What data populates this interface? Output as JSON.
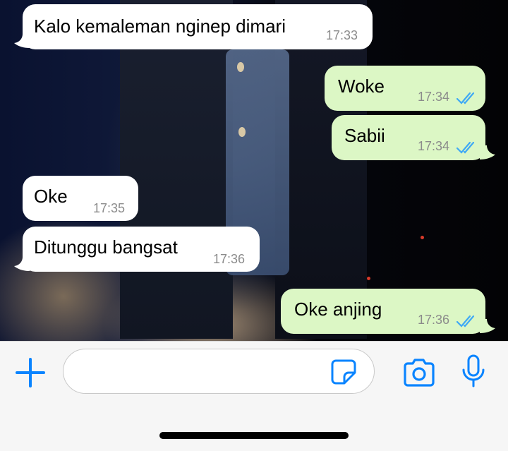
{
  "colors": {
    "incoming_bubble": "#ffffff",
    "outgoing_bubble": "#dcf7c5",
    "timestamp": "#8b8b8b",
    "read_ticks": "#3fa9f5",
    "accent": "#0a84ff"
  },
  "messages": [
    {
      "direction": "incoming",
      "text": "Kalo kemaleman nginep dimari",
      "time": "17:33"
    },
    {
      "direction": "outgoing",
      "text": "Woke",
      "time": "17:34",
      "status": "read"
    },
    {
      "direction": "outgoing",
      "text": "Sabii",
      "time": "17:34",
      "status": "read"
    },
    {
      "direction": "incoming",
      "text": "Oke",
      "time": "17:35"
    },
    {
      "direction": "incoming",
      "text": "Ditunggu bangsat",
      "time": "17:36"
    },
    {
      "direction": "outgoing",
      "text": "Oke anjing",
      "time": "17:36",
      "status": "read"
    }
  ],
  "composer": {
    "value": "",
    "icons": [
      "plus-icon",
      "sticker-icon",
      "camera-icon",
      "microphone-icon"
    ]
  }
}
